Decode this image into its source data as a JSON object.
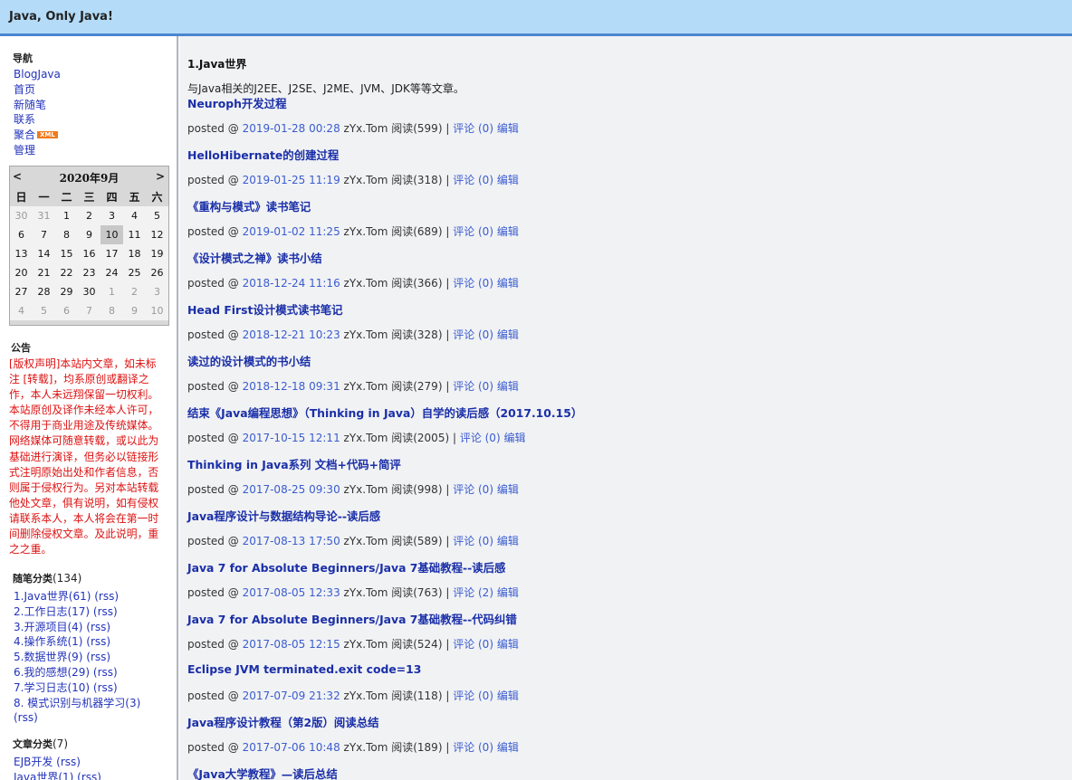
{
  "header": {
    "title": "Java, Only Java!"
  },
  "sidebar": {
    "nav_title": "导航",
    "nav_items": [
      {
        "label": "BlogJava"
      },
      {
        "label": "首页"
      },
      {
        "label": "新随笔"
      },
      {
        "label": "联系"
      },
      {
        "label": "聚合",
        "badge": "XML"
      },
      {
        "label": "管理"
      }
    ],
    "calendar": {
      "prev": "<",
      "next": ">",
      "title": "2020年9月",
      "weekdays": [
        "日",
        "一",
        "二",
        "三",
        "四",
        "五",
        "六"
      ],
      "weeks": [
        [
          "30",
          "31",
          "1",
          "2",
          "3",
          "4",
          "5"
        ],
        [
          "6",
          "7",
          "8",
          "9",
          "10",
          "11",
          "12"
        ],
        [
          "13",
          "14",
          "15",
          "16",
          "17",
          "18",
          "19"
        ],
        [
          "20",
          "21",
          "22",
          "23",
          "24",
          "25",
          "26"
        ],
        [
          "27",
          "28",
          "29",
          "30",
          "1",
          "2",
          "3"
        ],
        [
          "4",
          "5",
          "6",
          "7",
          "8",
          "9",
          "10"
        ]
      ],
      "today": "10"
    },
    "notice_title": "公告",
    "notice_text": "[版权声明]本站内文章，如未标注 [转载]，均系原创或翻译之作，本人未远翔保留一切权利。本站原创及译作未经本人许可，不得用于商业用途及传统媒体。网络媒体可随意转载，或以此为基础进行演译，但务必以链接形式注明原始出处和作者信息，否则属于侵权行为。另对本站转载他处文章，俱有说明，如有侵权请联系本人，本人将会在第一时间删除侵权文章。及此说明，重之之重。",
    "categories_title": "随笔分类",
    "categories_count": "(134)",
    "categories": [
      "1.Java世界(61) (rss)",
      "2.工作日志(17) (rss)",
      "3.开源项目(4) (rss)",
      "4.操作系统(1) (rss)",
      "5.数据世界(9) (rss)",
      "6.我的感想(29) (rss)",
      "7.学习日志(10) (rss)",
      "8. 模式识别与机器学习(3)",
      "(rss)"
    ],
    "articles_title": "文章分类",
    "articles_count": "(7)",
    "articles": [
      "EJB开发 (rss)",
      "Java世界(1) (rss)"
    ]
  },
  "main": {
    "section_title": "1.Java世界",
    "section_desc": "与Java相关的J2EE、J2SE、J2ME、JVM、JDK等等文章。",
    "posted_prefix": "posted @",
    "author": "zYx.Tom",
    "edit_label": "编辑",
    "posts": [
      {
        "title": "Neuroph开发过程",
        "date": "2019-01-28 00:28",
        "reads": "阅读(599)",
        "comments": "评论 (0)"
      },
      {
        "title": "HelloHibernate的创建过程",
        "date": "2019-01-25 11:19",
        "reads": "阅读(318)",
        "comments": "评论 (0)"
      },
      {
        "title": "《重构与模式》读书笔记",
        "date": "2019-01-02 11:25",
        "reads": "阅读(689)",
        "comments": "评论 (0)"
      },
      {
        "title": "《设计模式之禅》读书小结",
        "date": "2018-12-24 11:16",
        "reads": "阅读(366)",
        "comments": "评论 (0)"
      },
      {
        "title": "Head First设计模式读书笔记",
        "date": "2018-12-21 10:23",
        "reads": "阅读(328)",
        "comments": "评论 (0)"
      },
      {
        "title": "读过的设计模式的书小结",
        "date": "2018-12-18 09:31",
        "reads": "阅读(279)",
        "comments": "评论 (0)"
      },
      {
        "title": "结束《Java编程思想》（Thinking in Java）自学的读后感（2017.10.15）",
        "date": "2017-10-15 12:11",
        "reads": "阅读(2005)",
        "comments": "评论 (0)"
      },
      {
        "title": "Thinking in Java系列 文档+代码+简评",
        "date": "2017-08-25 09:30",
        "reads": "阅读(998)",
        "comments": "评论 (0)"
      },
      {
        "title": "Java程序设计与数据结构导论--读后感",
        "date": "2017-08-13 17:50",
        "reads": "阅读(589)",
        "comments": "评论 (0)"
      },
      {
        "title": "Java 7 for Absolute Beginners/Java 7基础教程--读后感",
        "date": "2017-08-05 12:33",
        "reads": "阅读(763)",
        "comments": "评论 (2)"
      },
      {
        "title": "Java 7 for Absolute Beginners/Java 7基础教程--代码纠错",
        "date": "2017-08-05 12:15",
        "reads": "阅读(524)",
        "comments": "评论 (0)"
      },
      {
        "title": "Eclipse JVM terminated.exit code=13",
        "date": "2017-07-09 21:32",
        "reads": "阅读(118)",
        "comments": "评论 (0)"
      },
      {
        "title": "Java程序设计教程（第2版）阅读总结",
        "date": "2017-07-06 10:48",
        "reads": "阅读(189)",
        "comments": "评论 (0)"
      },
      {
        "title": "《Java大学教程》—读后总结"
      }
    ]
  }
}
